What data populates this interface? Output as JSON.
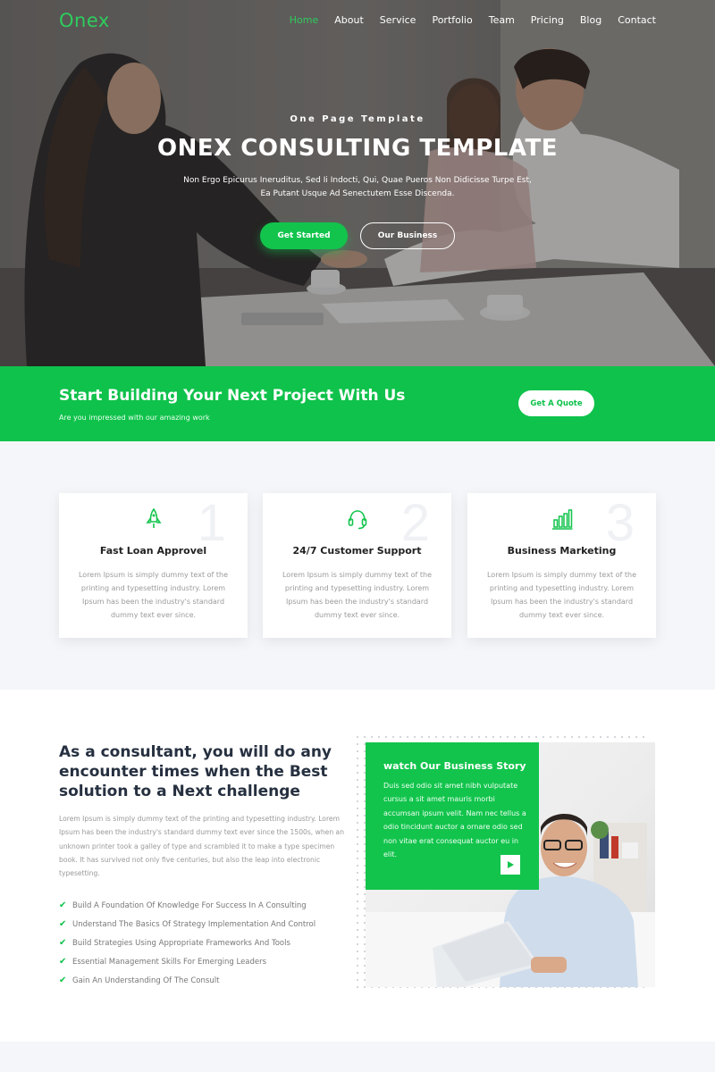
{
  "nav": {
    "logo": "Onex",
    "items": [
      {
        "label": "Home",
        "active": true
      },
      {
        "label": "About"
      },
      {
        "label": "Service"
      },
      {
        "label": "Portfolio"
      },
      {
        "label": "Team"
      },
      {
        "label": "Pricing"
      },
      {
        "label": "Blog"
      },
      {
        "label": "Contact"
      }
    ]
  },
  "hero": {
    "kicker": "One Page Template",
    "title": "ONEX CONSULTING TEMPLATE",
    "text": "Non Ergo Epicurus Ineruditus, Sed Ii Indocti, Qui, Quae Pueros Non Didicisse Turpe Est, Ea Putant Usque Ad Senectutem Esse Discenda.",
    "primary_button": "Get Started",
    "secondary_button": "Our Business"
  },
  "cta": {
    "title": "Start Building Your Next Project With Us",
    "subtitle": "Are you impressed with our amazing work",
    "button": "Get A Quote"
  },
  "features": [
    {
      "number": "1",
      "icon": "rocket-icon",
      "title": "Fast Loan Approvel",
      "text": "Lorem Ipsum is simply dummy text of the printing and typesetting industry. Lorem Ipsum has been the industry's standard dummy text ever since."
    },
    {
      "number": "2",
      "icon": "headset-icon",
      "title": "24/7 Customer Support",
      "text": "Lorem Ipsum is simply dummy text of the printing and typesetting industry. Lorem Ipsum has been the industry's standard dummy text ever since."
    },
    {
      "number": "3",
      "icon": "bar-chart-icon",
      "title": "Business Marketing",
      "text": "Lorem Ipsum is simply dummy text of the printing and typesetting industry. Lorem Ipsum has been the industry's standard dummy text ever since."
    }
  ],
  "about": {
    "title": "As a consultant, you will do any encounter times when the Best solution to a Next challenge",
    "text": "Lorem Ipsum is simply dummy text of the printing and typesetting industry. Lorem Ipsum has been the industry's standard dummy text ever since the 1500s, when an unknown printer took a galley of type and scrambled it to make a type specimen book. It has survived not only five centuries, but also the leap into electronic typesetting.",
    "checklist": [
      "Build A Foundation Of Knowledge For Success In A Consulting",
      "Understand The Basics Of Strategy Implementation And Control",
      "Build Strategies Using Appropriate Frameworks And Tools",
      "Essential Management Skills For Emerging Leaders",
      "Gain An Understanding Of The Consult"
    ]
  },
  "story": {
    "title": "watch Our Business Story",
    "text": "Duis sed odio sit amet nibh vulputate cursus a sit amet mauris morbi accumsan ipsum velit. Nam nec tellus a odio tincidunt auctor a ornare odio sed non vitae erat consequat auctor eu in elit."
  },
  "colors": {
    "accent": "#12c44c"
  }
}
